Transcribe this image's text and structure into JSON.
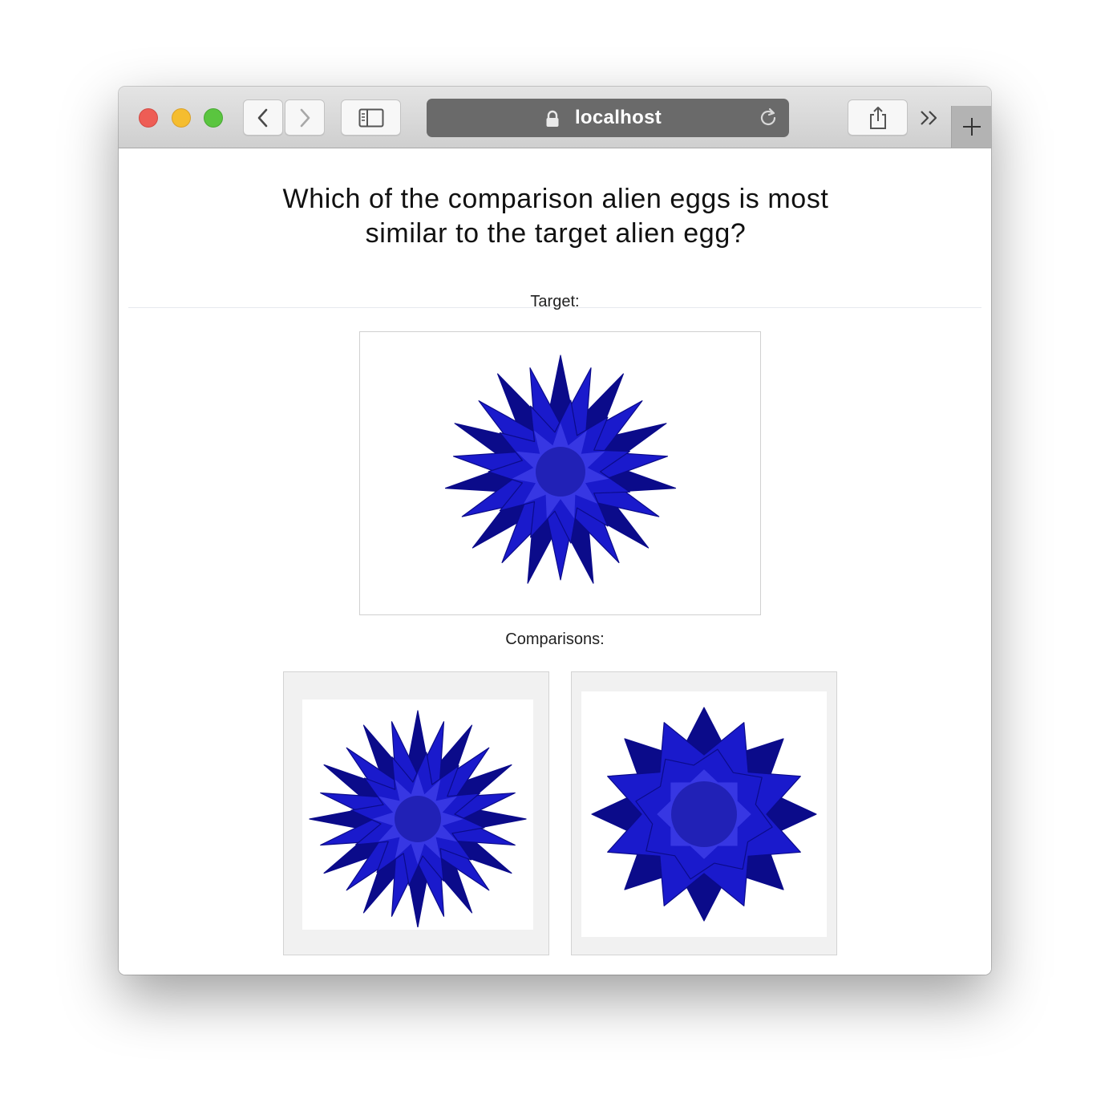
{
  "browser": {
    "address": "localhost",
    "icons": [
      "back-icon",
      "forward-icon",
      "sidebar-icon",
      "lock-icon",
      "reload-icon",
      "share-icon",
      "overflow-icon",
      "plus-icon"
    ]
  },
  "page": {
    "question_line1": "Which of the comparison alien eggs is most",
    "question_line2": "similar to the target alien egg?",
    "target_label": "Target:",
    "comparisons_label": "Comparisons:"
  },
  "colors": {
    "egg": "#1a1acc",
    "egg_dark": "#0b0b8a",
    "egg_light": "#5a5aff"
  }
}
